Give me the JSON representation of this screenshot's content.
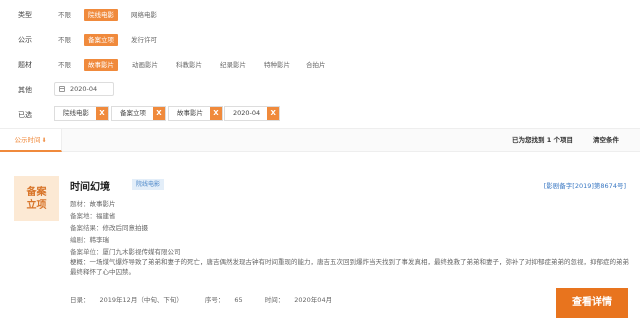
{
  "filters": {
    "type": {
      "label": "类型",
      "options": [
        "不限",
        "院线电影",
        "网络电影"
      ],
      "active": 1
    },
    "announce": {
      "label": "公示",
      "options": [
        "不限",
        "备案立项",
        "发行许可"
      ],
      "active": 1
    },
    "subject": {
      "label": "题材",
      "options": [
        "不限",
        "故事影片",
        "动画影片",
        "科教影片",
        "纪录影片",
        "特种影片",
        "合拍片"
      ],
      "active": 1
    },
    "other": {
      "label": "其他",
      "date_value": "2020-04"
    },
    "selected": {
      "label": "已选",
      "chips": [
        "院线电影",
        "备案立项",
        "故事影片",
        "2020-04"
      ],
      "remove_glyph": "X"
    }
  },
  "sort": {
    "tab_label": "公示时间",
    "tab_arrow": "⬇",
    "found_text": "已为您找到 1 个项目",
    "clear_label": "清空条件"
  },
  "accent_color": "#f08a3c",
  "card": {
    "badge_line1": "备案",
    "badge_line2": "立项",
    "title": "时间幻境",
    "tag": "院线电影",
    "reg_no": "[影剧备字[2019]第8674号]",
    "fields": [
      {
        "label": "题材：",
        "value": "故事影片"
      },
      {
        "label": "备案地：",
        "value": "福建省"
      },
      {
        "label": "备案结果：",
        "value": "修改后同意拍摄"
      },
      {
        "label": "编剧：",
        "value": "韩李瑞"
      },
      {
        "label": "备案单位：",
        "value": "厦门九木影视传媒有限公司"
      }
    ],
    "summary_label": "梗概：",
    "summary": "一场煤气爆炸导致了弟弟和妻子的死亡，唐吉偶然发现古钟有时间重现的能力，唐吉五次回到爆炸当天找到了事发真相，最终挽救了弟弟和妻子，弥补了对抑郁症弟弟的忽视，抑郁症的弟弟最终释怀了心中囚禁。",
    "meta": {
      "batch_label": "日录：",
      "batch_value": "2019年12月（中旬、下旬）",
      "seq_label": "序号：",
      "seq_value": "65",
      "time_label": "时间：",
      "time_value": "2020年04月"
    },
    "view_button": "查看详情"
  }
}
